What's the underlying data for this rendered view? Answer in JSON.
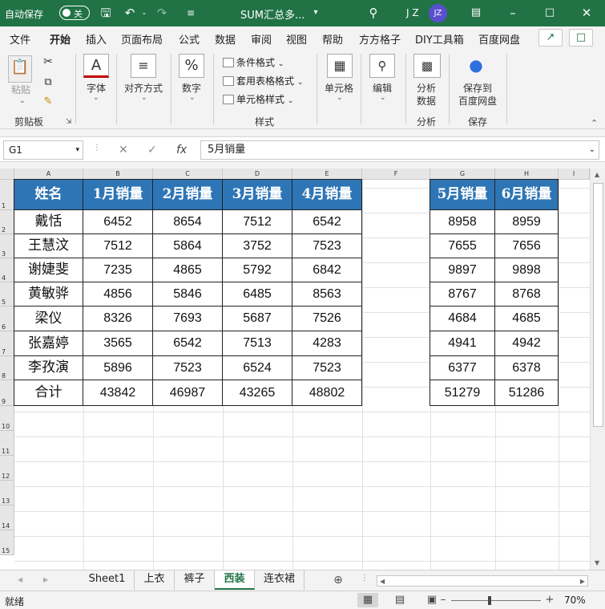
{
  "titlebar": {
    "autosave_label": "自动保存",
    "autosave_state": "关",
    "doc_title": "SUM汇总多...",
    "user_name": "J Z",
    "avatar_initials": "JZ",
    "icons": [
      "save-icon",
      "undo-icon",
      "redo-icon",
      "customize-icon",
      "search-icon",
      "ribbon-display-icon",
      "minimize-icon",
      "maximize-icon",
      "close-icon"
    ]
  },
  "menu": {
    "tabs": [
      "文件",
      "开始",
      "插入",
      "页面布局",
      "公式",
      "数据",
      "审阅",
      "视图",
      "帮助",
      "方方格子",
      "DIY工具箱",
      "百度网盘"
    ],
    "active": "开始"
  },
  "ribbon": {
    "clipboard": {
      "paste": "粘贴",
      "group": "剪贴板"
    },
    "font": {
      "label": "字体",
      "icon_text": "A"
    },
    "align": {
      "label": "对齐方式"
    },
    "number": {
      "label": "数字",
      "icon_text": "%"
    },
    "styles": {
      "cond_format": "条件格式",
      "table_format": "套用表格格式",
      "cell_styles": "单元格样式",
      "group": "样式"
    },
    "cells": {
      "label": "单元格"
    },
    "edit": {
      "label": "编辑"
    },
    "analysis": {
      "label1": "分析",
      "label2": "数据",
      "group": "分析"
    },
    "save": {
      "label1": "保存到",
      "label2": "百度网盘",
      "group": "保存"
    }
  },
  "formula_bar": {
    "name_box": "G1",
    "fx": "fx",
    "content": "5月销量"
  },
  "columns": [
    "A",
    "B",
    "C",
    "D",
    "E",
    "F",
    "G",
    "H",
    "I"
  ],
  "rows": [
    "1",
    "2",
    "3",
    "4",
    "5",
    "6",
    "7",
    "8",
    "9",
    "10",
    "11",
    "12",
    "13",
    "14",
    "15"
  ],
  "table1": {
    "headers": [
      "姓名",
      "1月销量",
      "2月销量",
      "3月销量",
      "4月销量"
    ],
    "rows": [
      [
        "戴恬",
        "6452",
        "8654",
        "7512",
        "6542"
      ],
      [
        "王慧汶",
        "7512",
        "5864",
        "3752",
        "7523"
      ],
      [
        "谢婕斐",
        "7235",
        "4865",
        "5792",
        "6842"
      ],
      [
        "黄敏骅",
        "4856",
        "5846",
        "6485",
        "8563"
      ],
      [
        "梁仪",
        "8326",
        "7693",
        "5687",
        "7526"
      ],
      [
        "张嘉婷",
        "3565",
        "6542",
        "7513",
        "4283"
      ],
      [
        "李孜演",
        "5896",
        "7523",
        "6524",
        "7523"
      ],
      [
        "合计",
        "43842",
        "46987",
        "43265",
        "48802"
      ]
    ]
  },
  "table2": {
    "headers": [
      "5月销量",
      "6月销量"
    ],
    "rows": [
      [
        "8958",
        "8959"
      ],
      [
        "7655",
        "7656"
      ],
      [
        "9897",
        "9898"
      ],
      [
        "8767",
        "8768"
      ],
      [
        "4684",
        "4685"
      ],
      [
        "4941",
        "4942"
      ],
      [
        "6377",
        "6378"
      ],
      [
        "51279",
        "51286"
      ]
    ]
  },
  "sheets": {
    "tabs": [
      "Sheet1",
      "上衣",
      "裤子",
      "西装",
      "连衣裙"
    ],
    "active": "西装"
  },
  "status": {
    "ready": "就绪",
    "zoom": "70%"
  }
}
